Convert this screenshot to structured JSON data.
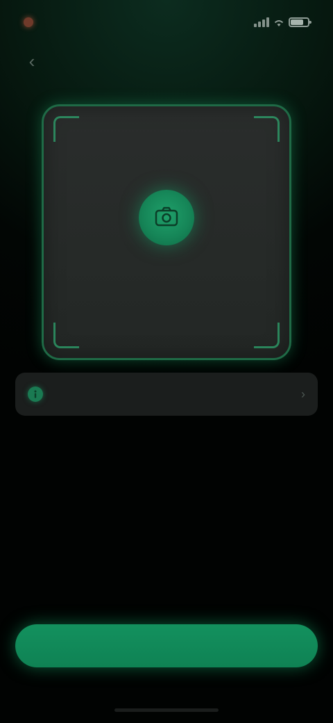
{
  "status_bar": {
    "left_text": "",
    "time": ""
  },
  "header": {
    "back_glyph": "‹",
    "title": ""
  },
  "scanner": {
    "label": "",
    "hint": "",
    "icon": "camera-icon"
  },
  "info_row": {
    "text": "",
    "icon": "info-icon",
    "chevron": "›"
  },
  "primary_button": {
    "label": ""
  },
  "colors": {
    "accent": "#14905d",
    "frame_border": "#1f6a46",
    "background": "#010403",
    "card": "#1b1e1d"
  }
}
